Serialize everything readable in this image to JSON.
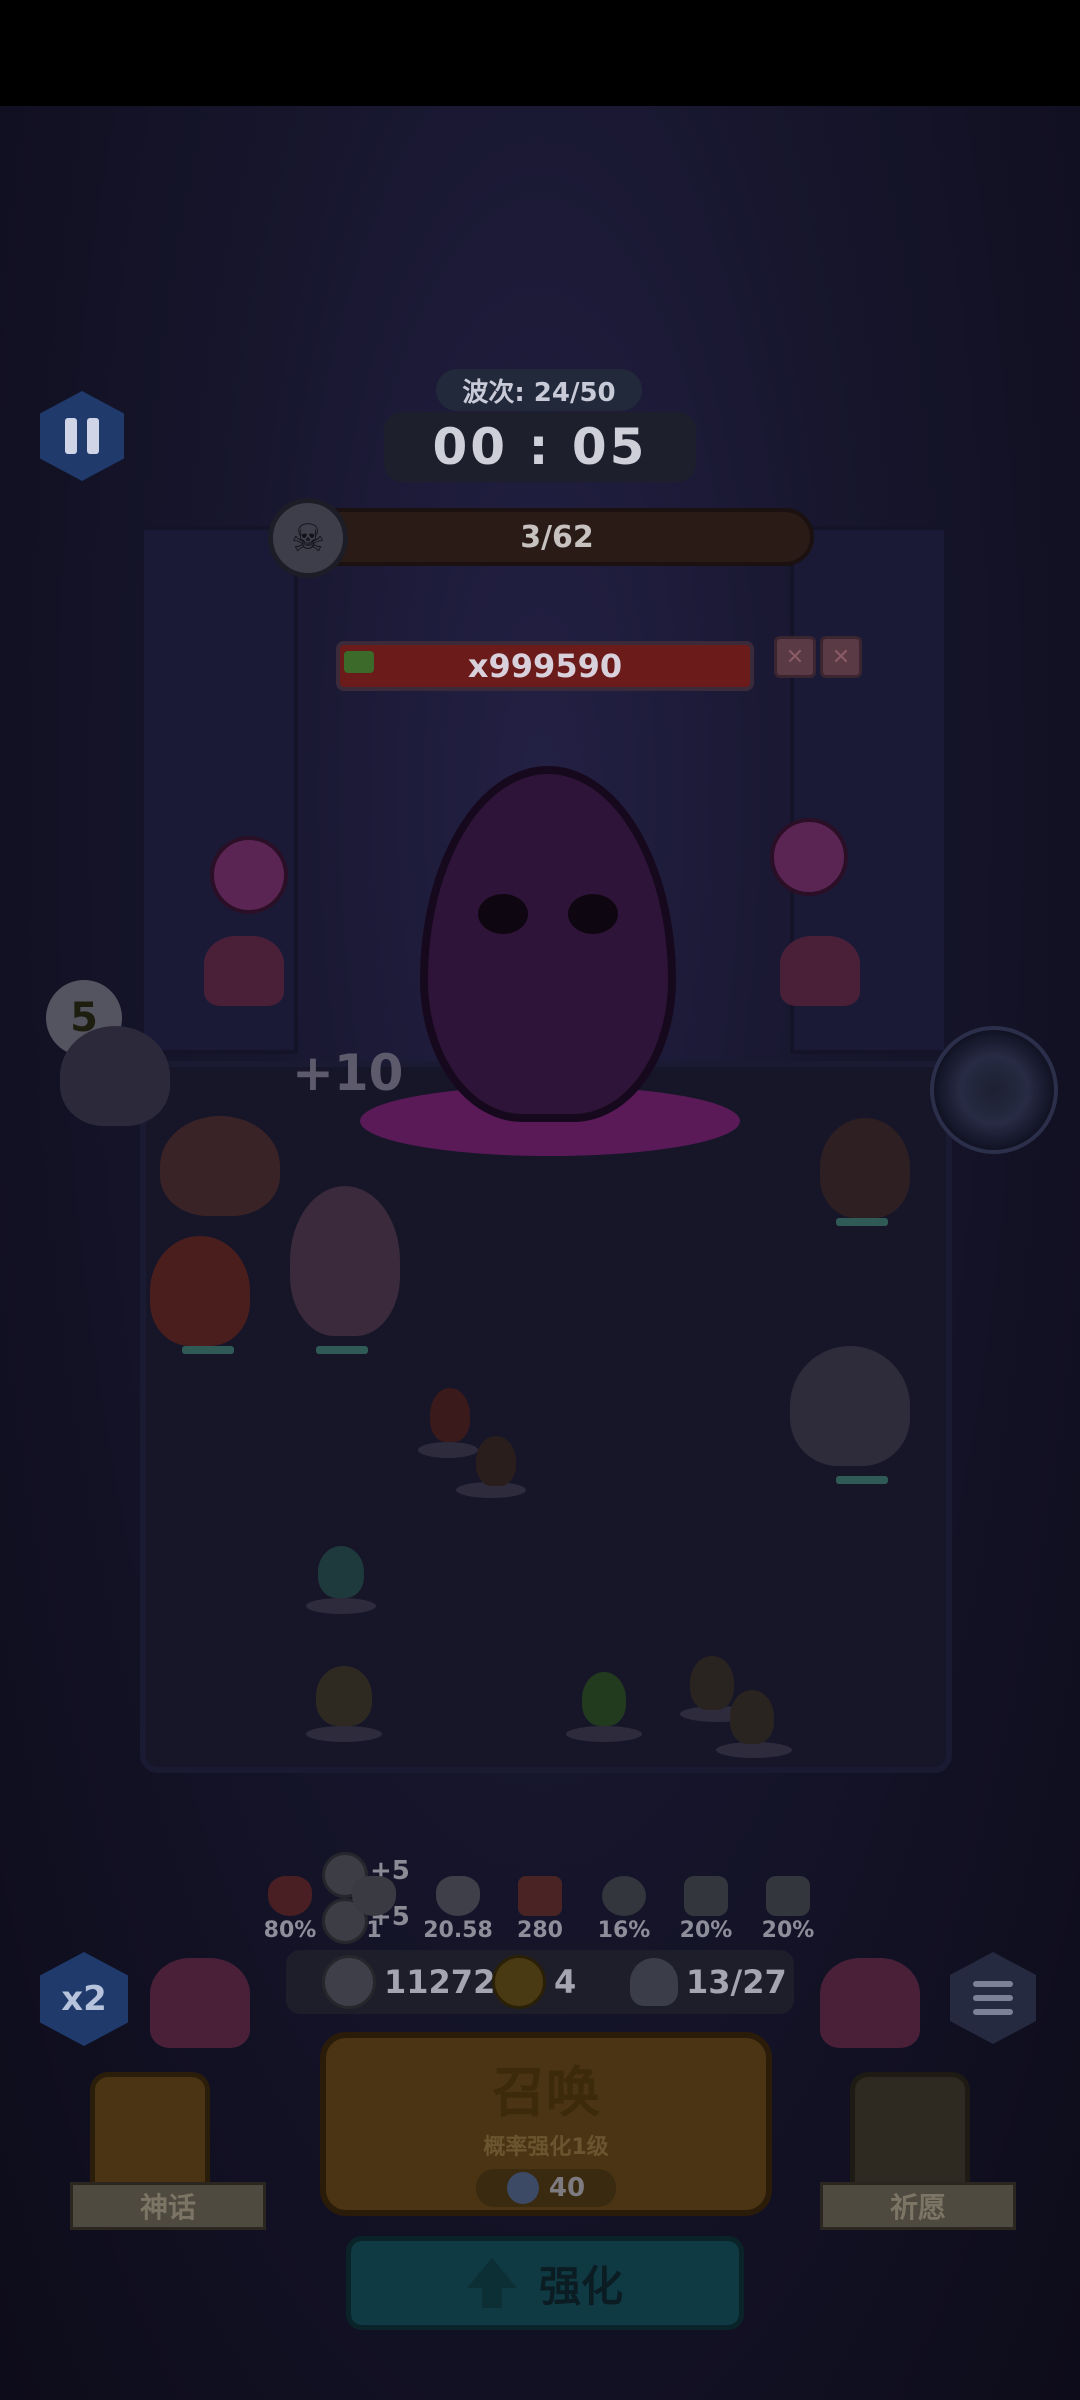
{
  "hud": {
    "wave_label": "波次: 24/50",
    "timer": "00 : 05",
    "kill_count": "3/62",
    "boss_hp": "x999590"
  },
  "arena": {
    "bonus_popup": "+10",
    "speech_bubble": "5"
  },
  "stats": {
    "bonus_top": "+5",
    "bonus_bottom": "+5",
    "items": [
      {
        "icon": "heart-icon",
        "value": "80%"
      },
      {
        "icon": "heart-level-icon",
        "value": "1"
      },
      {
        "icon": "crit-heart-icon",
        "value": "20.58"
      },
      {
        "icon": "attack-icon",
        "value": "280"
      },
      {
        "icon": "speed-up-icon",
        "value": "16%"
      },
      {
        "icon": "fist-up-icon",
        "value": "20%"
      },
      {
        "icon": "boot-up-icon",
        "value": "20%"
      }
    ]
  },
  "resources": {
    "silver": "11272",
    "clover": "4",
    "units": "13/27"
  },
  "buttons": {
    "speed": "x2",
    "summon_title": "召唤",
    "summon_sub": "概率强化1级",
    "summon_cost": "40",
    "myth": "神话",
    "wish": "祈愿",
    "upgrade": "强化"
  },
  "colors": {
    "overlay_dim": "#0d0c1a",
    "summon_gold": "#4a3413",
    "upgrade_teal": "#0f3a44",
    "hud_blue": "#1f3a6b"
  }
}
